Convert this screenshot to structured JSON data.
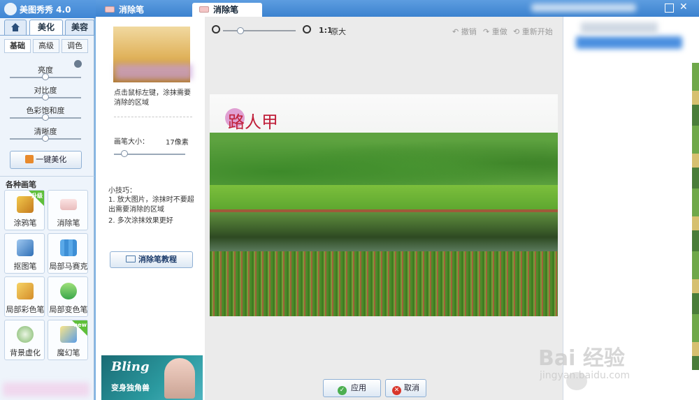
{
  "app": {
    "title": "美图秀秀 4.0"
  },
  "main_tabs": [
    {
      "label": "美化"
    },
    {
      "label": "美容"
    }
  ],
  "sub_tabs": [
    {
      "label": "基础"
    },
    {
      "label": "高级"
    },
    {
      "label": "调色"
    }
  ],
  "sliders": [
    {
      "label": "亮度"
    },
    {
      "label": "对比度"
    },
    {
      "label": "色彩饱和度"
    },
    {
      "label": "清晰度"
    }
  ],
  "one_click_button": "一键美化",
  "brushes_heading": "各种画笔",
  "tools": [
    {
      "label": "涂鸦笔",
      "badge": "升级"
    },
    {
      "label": "消除笔"
    },
    {
      "label": "抠图笔"
    },
    {
      "label": "局部马赛克"
    },
    {
      "label": "局部彩色笔"
    },
    {
      "label": "局部变色笔"
    },
    {
      "label": "背景虚化"
    },
    {
      "label": "魔幻笔",
      "badge": "new"
    }
  ],
  "dialog": {
    "inactive_tab": "消除笔",
    "active_tab": "消除笔",
    "instruction": "点击鼠标左键，涂抹需要消除的区域",
    "brush_size_label": "画笔大小：",
    "brush_size_value": "17像素",
    "tips_title": "小技巧：",
    "tips": [
      "1. 放大图片，涂抹时不要超出需要消除的区域",
      "2. 多次涂抹效果更好"
    ],
    "tutorial_button": "消除笔教程",
    "ad": {
      "title": "Bling",
      "subtitle": "变身独角兽"
    },
    "toolbar": {
      "ratio": "1:1",
      "ratio_label": "原大",
      "undo": "撤销",
      "redo": "重做",
      "reset": "重新开始"
    },
    "photo_text": "路人甲",
    "apply_button": "应用",
    "cancel_button": "取消"
  },
  "watermark": {
    "brand": "Bai  经验",
    "url": "jingyan.baidu.com"
  },
  "colors": {
    "titlebar": "#3f86d4",
    "accent": "#5fbf3a",
    "photo_text": "#c0203a"
  }
}
